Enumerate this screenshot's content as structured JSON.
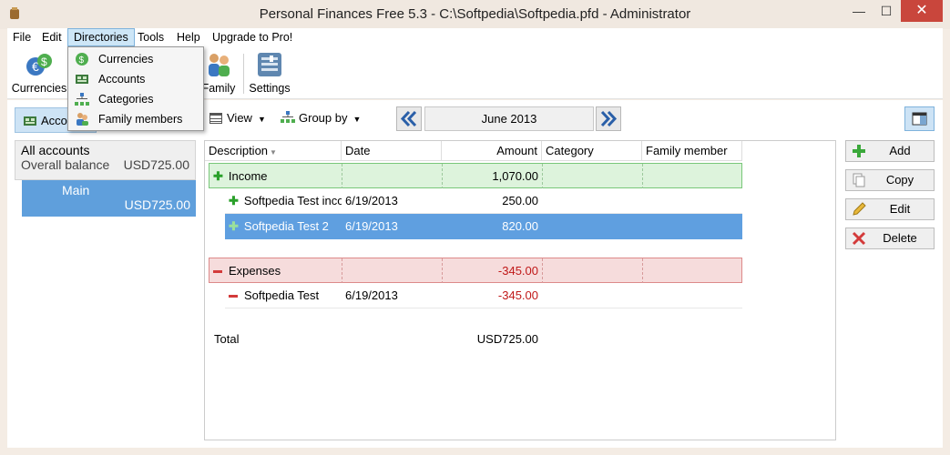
{
  "window": {
    "title": "Personal Finances Free 5.3 - C:\\Softpedia\\Softpedia.pfd - Administrator",
    "minimize": "—",
    "maximize": "☐",
    "close": "✕"
  },
  "menubar": {
    "items": [
      "File",
      "Edit",
      "Directories",
      "Tools",
      "Help",
      "Upgrade to Pro!"
    ],
    "active": "Directories"
  },
  "toolbar": {
    "currencies_label": "Currencies",
    "family_label": "Family",
    "settings_label": "Settings"
  },
  "directories_menu": {
    "items": [
      {
        "label": "Currencies",
        "icon": "currency-icon"
      },
      {
        "label": "Accounts",
        "icon": "accounts-icon"
      },
      {
        "label": "Categories",
        "icon": "categories-icon"
      },
      {
        "label": "Family members",
        "icon": "family-members-icon"
      }
    ]
  },
  "filters": {
    "accounts_tab": "Accounts",
    "view_label": "View",
    "group_by_label": "Group by",
    "month": "June 2013"
  },
  "accounts_panel": {
    "all_accounts": "All accounts",
    "overall_balance_label": "Overall balance",
    "overall_balance": "USD725.00",
    "main_account": "Main",
    "main_balance": "USD725.00"
  },
  "grid": {
    "columns": [
      "Description",
      "Date",
      "Amount",
      "Category",
      "Family member"
    ],
    "groups": [
      {
        "name": "Income",
        "total": "1,070.00",
        "rows": [
          {
            "description": "Softpedia Test income",
            "date": "6/19/2013",
            "amount": "250.00",
            "selected": false
          },
          {
            "description": "Softpedia Test 2",
            "date": "6/19/2013",
            "amount": "820.00",
            "selected": true
          }
        ]
      },
      {
        "name": "Expenses",
        "total": "-345.00",
        "rows": [
          {
            "description": "Softpedia Test",
            "date": "6/19/2013",
            "amount": "-345.00",
            "selected": false
          }
        ]
      }
    ],
    "total_label": "Total",
    "total_value": "USD725.00"
  },
  "actions": {
    "add": "Add",
    "copy": "Copy",
    "edit": "Edit",
    "delete": "Delete"
  },
  "colors": {
    "selection": "#5f9fe0",
    "income_bg": "#ddf3dc",
    "expense_bg": "#f6dcdc",
    "close_button": "#c9463c"
  }
}
